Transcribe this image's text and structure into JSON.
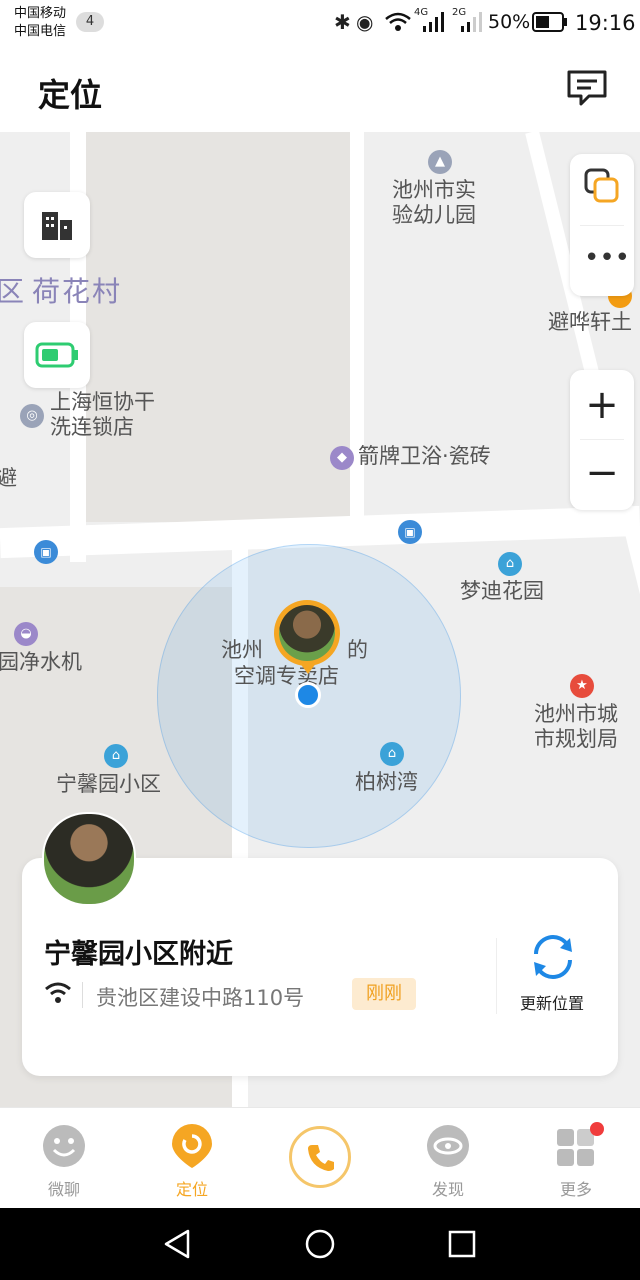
{
  "status_bar": {
    "carrier1": "中国移动",
    "carrier2": "中国电信",
    "badge": "4",
    "network1": "4G",
    "network2": "2G",
    "battery": "50%",
    "time": "19:16"
  },
  "header": {
    "title": "定位"
  },
  "map": {
    "labels": {
      "district": "荷花村",
      "edge_left": "区",
      "school": "池州市实\n验幼儿园",
      "shop_right": "避哗轩土",
      "laundry": "上海恒协干\n洗连锁店",
      "tiles": "箭牌卫浴·瓷砖",
      "edge_left2": "避",
      "garden": "梦迪花园",
      "water": "园净水机",
      "ac_store": "池州万    的\n空调专卖店",
      "ac_store_a": "池州",
      "ac_store_b": "的",
      "ac_store_c": "空调专卖店",
      "planning": "池州市城\n市规划局",
      "community": "宁馨园小区",
      "baishuwan": "柏树湾"
    },
    "accuracy_fraction": 0.5
  },
  "card": {
    "place": "宁馨园小区附近",
    "address": "贵池区建设中路110号",
    "time_tag": "刚刚",
    "refresh_label": "更新位置"
  },
  "nav": {
    "items": [
      {
        "label": "微聊",
        "active": false
      },
      {
        "label": "定位",
        "active": true
      },
      {
        "label": "",
        "active": false
      },
      {
        "label": "发现",
        "active": false
      },
      {
        "label": "更多",
        "active": false
      }
    ]
  },
  "colors": {
    "accent": "#f5a623",
    "blue": "#1e88e5",
    "map_bg": "#efefef",
    "green": "#2ecc71"
  }
}
